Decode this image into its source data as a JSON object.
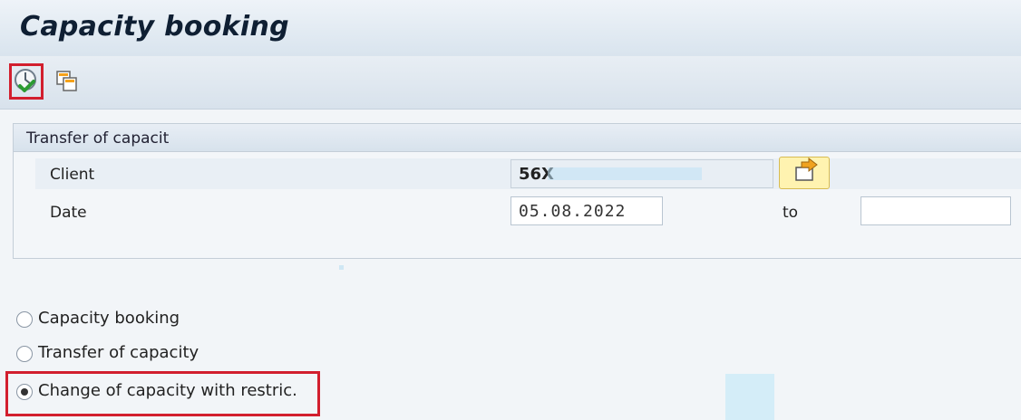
{
  "title": "Capacity booking",
  "toolbar": {
    "execute_icon": "execute-clock-check-icon",
    "copy_icon": "copy-windows-icon"
  },
  "group": {
    "title": "Transfer of capacit",
    "client": {
      "label": "Client",
      "value": "56X"
    },
    "date": {
      "label": "Date",
      "value": "05.08.2022",
      "to_label": "to",
      "to_value": ""
    }
  },
  "options": [
    {
      "label": "Capacity booking",
      "checked": false
    },
    {
      "label": "Transfer of capacity",
      "checked": false
    },
    {
      "label": "Change of capacity with restric.",
      "checked": true
    }
  ],
  "colors": {
    "highlight": "#d21f2e",
    "accent_button": "#fff3b0"
  }
}
